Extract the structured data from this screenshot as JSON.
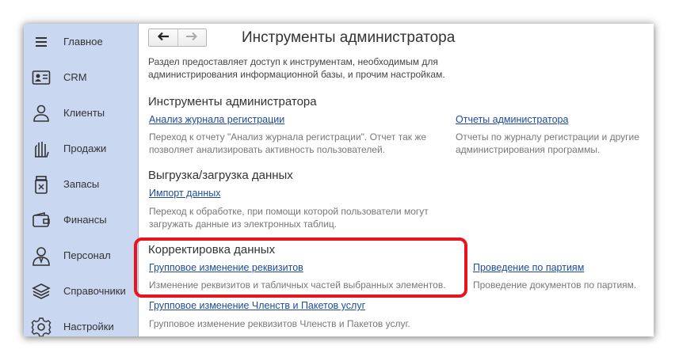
{
  "sidebar": {
    "items": [
      {
        "label": "Главное",
        "icon": "menu-lines-icon"
      },
      {
        "label": "CRM",
        "icon": "contact-card-icon"
      },
      {
        "label": "Клиенты",
        "icon": "person-icon"
      },
      {
        "label": "Продажи",
        "icon": "hand-icon"
      },
      {
        "label": "Запасы",
        "icon": "jar-icon"
      },
      {
        "label": "Финансы",
        "icon": "wallet-icon"
      },
      {
        "label": "Персонал",
        "icon": "employee-icon"
      },
      {
        "label": "Справочники",
        "icon": "layers-icon"
      },
      {
        "label": "Настройки",
        "icon": "gear-icon"
      }
    ]
  },
  "header": {
    "title": "Инструменты администратора",
    "back_icon": "arrow-left-icon",
    "forward_icon": "arrow-right-icon"
  },
  "intro": "Раздел предоставляет доступ к инструментам, необходимым для администрирования информационной базы, и прочим настройкам.",
  "sections": {
    "admin_tools": {
      "title": "Инструменты администратора",
      "link1": "Анализ журнала регистрации",
      "desc1": "Переход к отчету \"Анализ журнала регистрации\". Отчет так же позволяет анализировать активность пользователей.",
      "link2": "Отчеты администратора",
      "desc2": "Отчеты по журналу регистрации и другие администрирования программы."
    },
    "import": {
      "title": "Выгрузка/загрузка данных",
      "link1": "Импорт данных",
      "desc1": "Переход к обработке, при помощи которой пользователи могут загружать данные из электронных таблиц."
    },
    "correction": {
      "title": "Корректировка данных",
      "link1": "Групповое изменение реквизитов",
      "desc1": "Изменение реквизитов и табличных частей выбранных элементов.",
      "link2": "Проведение по партиям",
      "desc2": "Проведение документов по партиям.",
      "link3": "Групповое изменение Членств и Пакетов услуг",
      "desc3": "Групповое изменение реквизитов Членств и Пакетов услуг."
    }
  },
  "colors": {
    "sidebar_bg": "#c9d7f0",
    "link": "#1d4b9a",
    "highlight": "#e8141f"
  }
}
